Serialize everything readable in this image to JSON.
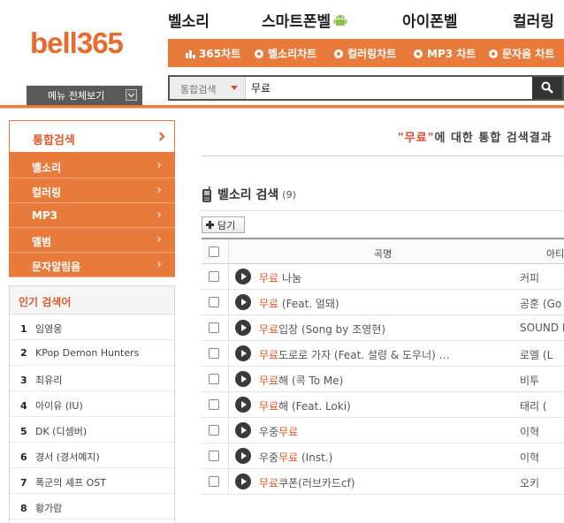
{
  "logo": "bell365",
  "topnav": [
    {
      "label": "벨소리"
    },
    {
      "label": "스마트폰벨"
    },
    {
      "label": "아이폰벨"
    },
    {
      "label": "컬러링"
    }
  ],
  "subnav": [
    "365차트",
    "벨소리차트",
    "컬러링차트",
    "MP3 차트",
    "문자음 차트"
  ],
  "menu_all": "메뉴 전체보기",
  "search": {
    "scope": "통합검색",
    "query": "무료"
  },
  "sidebar": {
    "active": "통합검색",
    "items": [
      "벨소리",
      "컬러링",
      "MP3",
      "앨범",
      "문자알림음"
    ]
  },
  "popular": {
    "title": "인기 검색어",
    "items": [
      {
        "rank": "1",
        "term": "임영웅"
      },
      {
        "rank": "2",
        "term": "KPop Demon Hunters"
      },
      {
        "rank": "3",
        "term": "최유리"
      },
      {
        "rank": "4",
        "term": "아이유 (IU)"
      },
      {
        "rank": "5",
        "term": "DK (디셈버)"
      },
      {
        "rank": "6",
        "term": "경서 (경서예지)"
      },
      {
        "rank": "7",
        "term": "폭군의 셰프 OST"
      },
      {
        "rank": "8",
        "term": "황가람"
      }
    ]
  },
  "main": {
    "title_query": "\"무료\"",
    "title_rest": "에 대한 통합 검색결과",
    "section_title": "벨소리 검색",
    "section_count": "(9)",
    "add_button": "담기",
    "col_title": "곡명",
    "col_artist": "아티스트",
    "rows": [
      {
        "hl": "무료",
        "rest": " 나눔",
        "artist": "커피"
      },
      {
        "hl": "무료",
        "rest": " (Feat. 얼돼)",
        "artist": "공훈 (Go"
      },
      {
        "hl": "무료",
        "rest": "입장 (Song by 조영현)",
        "artist": "SOUND F"
      },
      {
        "hl": "무료",
        "rest": "도로로 가자 (Feat. 설령 & 도우너) …",
        "artist": "로엘 (L"
      },
      {
        "hl": "무료",
        "rest": "해 (콕 To Me)",
        "artist": "비투"
      },
      {
        "hl": "무료",
        "rest": "해 (Feat. Loki)",
        "artist": "태리 ("
      },
      {
        "pre": "우중",
        "hl": "무료",
        "rest": "",
        "artist": "이혁"
      },
      {
        "pre": "우중",
        "hl": "무료",
        "rest": " (Inst.)",
        "artist": "이혁"
      },
      {
        "hl": "무료",
        "rest": "쿠폰(러브카드cf)",
        "artist": "오키"
      }
    ]
  },
  "colors": {
    "accent": "#e87a3c",
    "highlight": "#e0592a"
  }
}
